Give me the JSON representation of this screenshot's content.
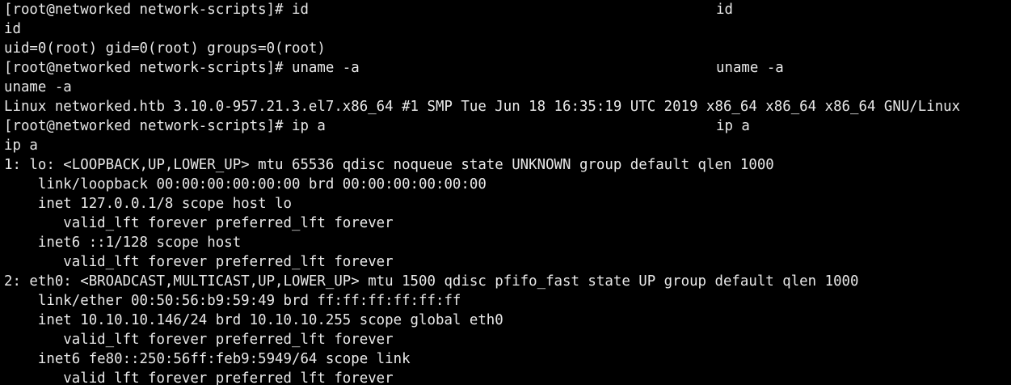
{
  "terminal": {
    "background": "#000000",
    "foreground": "#e8e8e8",
    "lines": [
      {
        "text": "[root@networked network-scripts]# id",
        "echo": "id"
      },
      {
        "text": "id",
        "echo": ""
      },
      {
        "text": "uid=0(root) gid=0(root) groups=0(root)",
        "echo": ""
      },
      {
        "text": "[root@networked network-scripts]# uname -a",
        "echo": "uname -a"
      },
      {
        "text": "uname -a",
        "echo": ""
      },
      {
        "text": "Linux networked.htb 3.10.0-957.21.3.el7.x86_64 #1 SMP Tue Jun 18 16:35:19 UTC 2019 x86_64 x86_64 x86_64 GNU/Linux",
        "echo": ""
      },
      {
        "text": "[root@networked network-scripts]# ip a",
        "echo": "ip a"
      },
      {
        "text": "ip a",
        "echo": ""
      },
      {
        "text": "1: lo: <LOOPBACK,UP,LOWER_UP> mtu 65536 qdisc noqueue state UNKNOWN group default qlen 1000",
        "echo": ""
      },
      {
        "text": "    link/loopback 00:00:00:00:00:00 brd 00:00:00:00:00:00",
        "echo": ""
      },
      {
        "text": "    inet 127.0.0.1/8 scope host lo",
        "echo": ""
      },
      {
        "text": "       valid_lft forever preferred_lft forever",
        "echo": ""
      },
      {
        "text": "    inet6 ::1/128 scope host",
        "echo": ""
      },
      {
        "text": "       valid_lft forever preferred_lft forever",
        "echo": ""
      },
      {
        "text": "2: eth0: <BROADCAST,MULTICAST,UP,LOWER_UP> mtu 1500 qdisc pfifo_fast state UP group default qlen 1000",
        "echo": ""
      },
      {
        "text": "    link/ether 00:50:56:b9:59:49 brd ff:ff:ff:ff:ff:ff",
        "echo": ""
      },
      {
        "text": "    inet 10.10.10.146/24 brd 10.10.10.255 scope global eth0",
        "echo": ""
      },
      {
        "text": "       valid_lft forever preferred_lft forever",
        "echo": ""
      },
      {
        "text": "    inet6 fe80::250:56ff:feb9:5949/64 scope link",
        "echo": ""
      },
      {
        "text": "       valid_lft forever preferred_lft forever",
        "echo": ""
      }
    ]
  }
}
